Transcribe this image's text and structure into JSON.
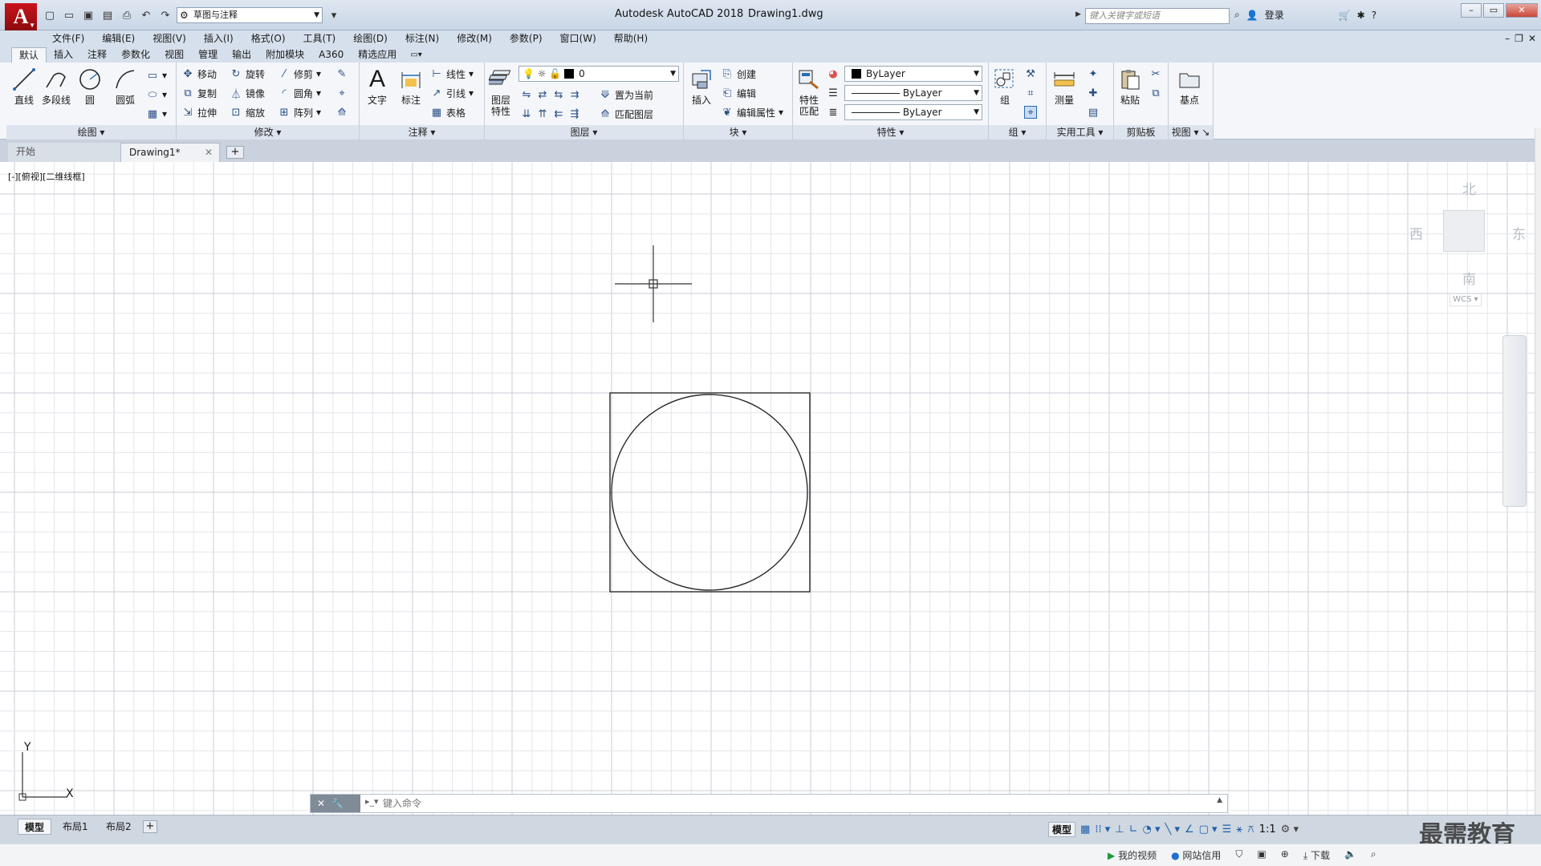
{
  "app": {
    "title": "Autodesk AutoCAD 2018",
    "file": "Drawing1.dwg",
    "logo": "A",
    "workspace": "草图与注释",
    "search_placeholder": "键入关键字或短语",
    "login": "登录"
  },
  "menu": [
    "文件(F)",
    "编辑(E)",
    "视图(V)",
    "插入(I)",
    "格式(O)",
    "工具(T)",
    "绘图(D)",
    "标注(N)",
    "修改(M)",
    "参数(P)",
    "窗口(W)",
    "帮助(H)"
  ],
  "ribbon_tabs": [
    "默认",
    "插入",
    "注释",
    "参数化",
    "视图",
    "管理",
    "输出",
    "附加模块",
    "A360",
    "精选应用"
  ],
  "panels": {
    "draw": {
      "title": "绘图",
      "line": "直线",
      "polyline": "多段线",
      "circle": "圆",
      "arc": "圆弧"
    },
    "modify": {
      "title": "修改",
      "move": "移动",
      "rotate": "旋转",
      "trim": "修剪",
      "copy": "复制",
      "mirror": "镜像",
      "fillet": "圆角",
      "stretch": "拉伸",
      "scale": "缩放",
      "array": "阵列"
    },
    "annotation": {
      "title": "注释",
      "text": "文字",
      "dimension": "标注",
      "linear": "线性",
      "leader": "引线",
      "table": "表格"
    },
    "layers": {
      "title": "图层",
      "layer_props_1": "图层",
      "layer_props_2": "特性",
      "current_layer": "0",
      "set_current": "置为当前",
      "match_layer": "匹配图层"
    },
    "block": {
      "title": "块",
      "insert": "插入",
      "create": "创建",
      "edit": "编辑",
      "edit_attr": "编辑属性"
    },
    "properties": {
      "title": "特性",
      "match_1": "特性",
      "match_2": "匹配",
      "color": "ByLayer",
      "linetype": "ByLayer",
      "lineweight": "ByLayer"
    },
    "groups": {
      "title": "组",
      "group": "组"
    },
    "utilities": {
      "title": "实用工具",
      "measure": "测量"
    },
    "clipboard": {
      "title": "剪贴板",
      "paste": "粘贴"
    },
    "view": {
      "title": "视图",
      "base": "基点"
    }
  },
  "file_tabs": {
    "start": "开始",
    "doc": "Drawing1*"
  },
  "viewport_label": "[-][俯视][二维线框]",
  "viewcube": {
    "north": "北",
    "south": "南",
    "east": "东",
    "west": "西",
    "wcs": "WCS"
  },
  "ucs": {
    "x": "X",
    "y": "Y"
  },
  "command": {
    "placeholder": "键入命令"
  },
  "layout_tabs": [
    "模型",
    "布局1",
    "布局2"
  ],
  "status": {
    "model": "模型",
    "scale": "1:1"
  },
  "watermark": "最需教育",
  "bottom": {
    "video": "我的视频",
    "credit": "网站信用",
    "download": "下载"
  }
}
